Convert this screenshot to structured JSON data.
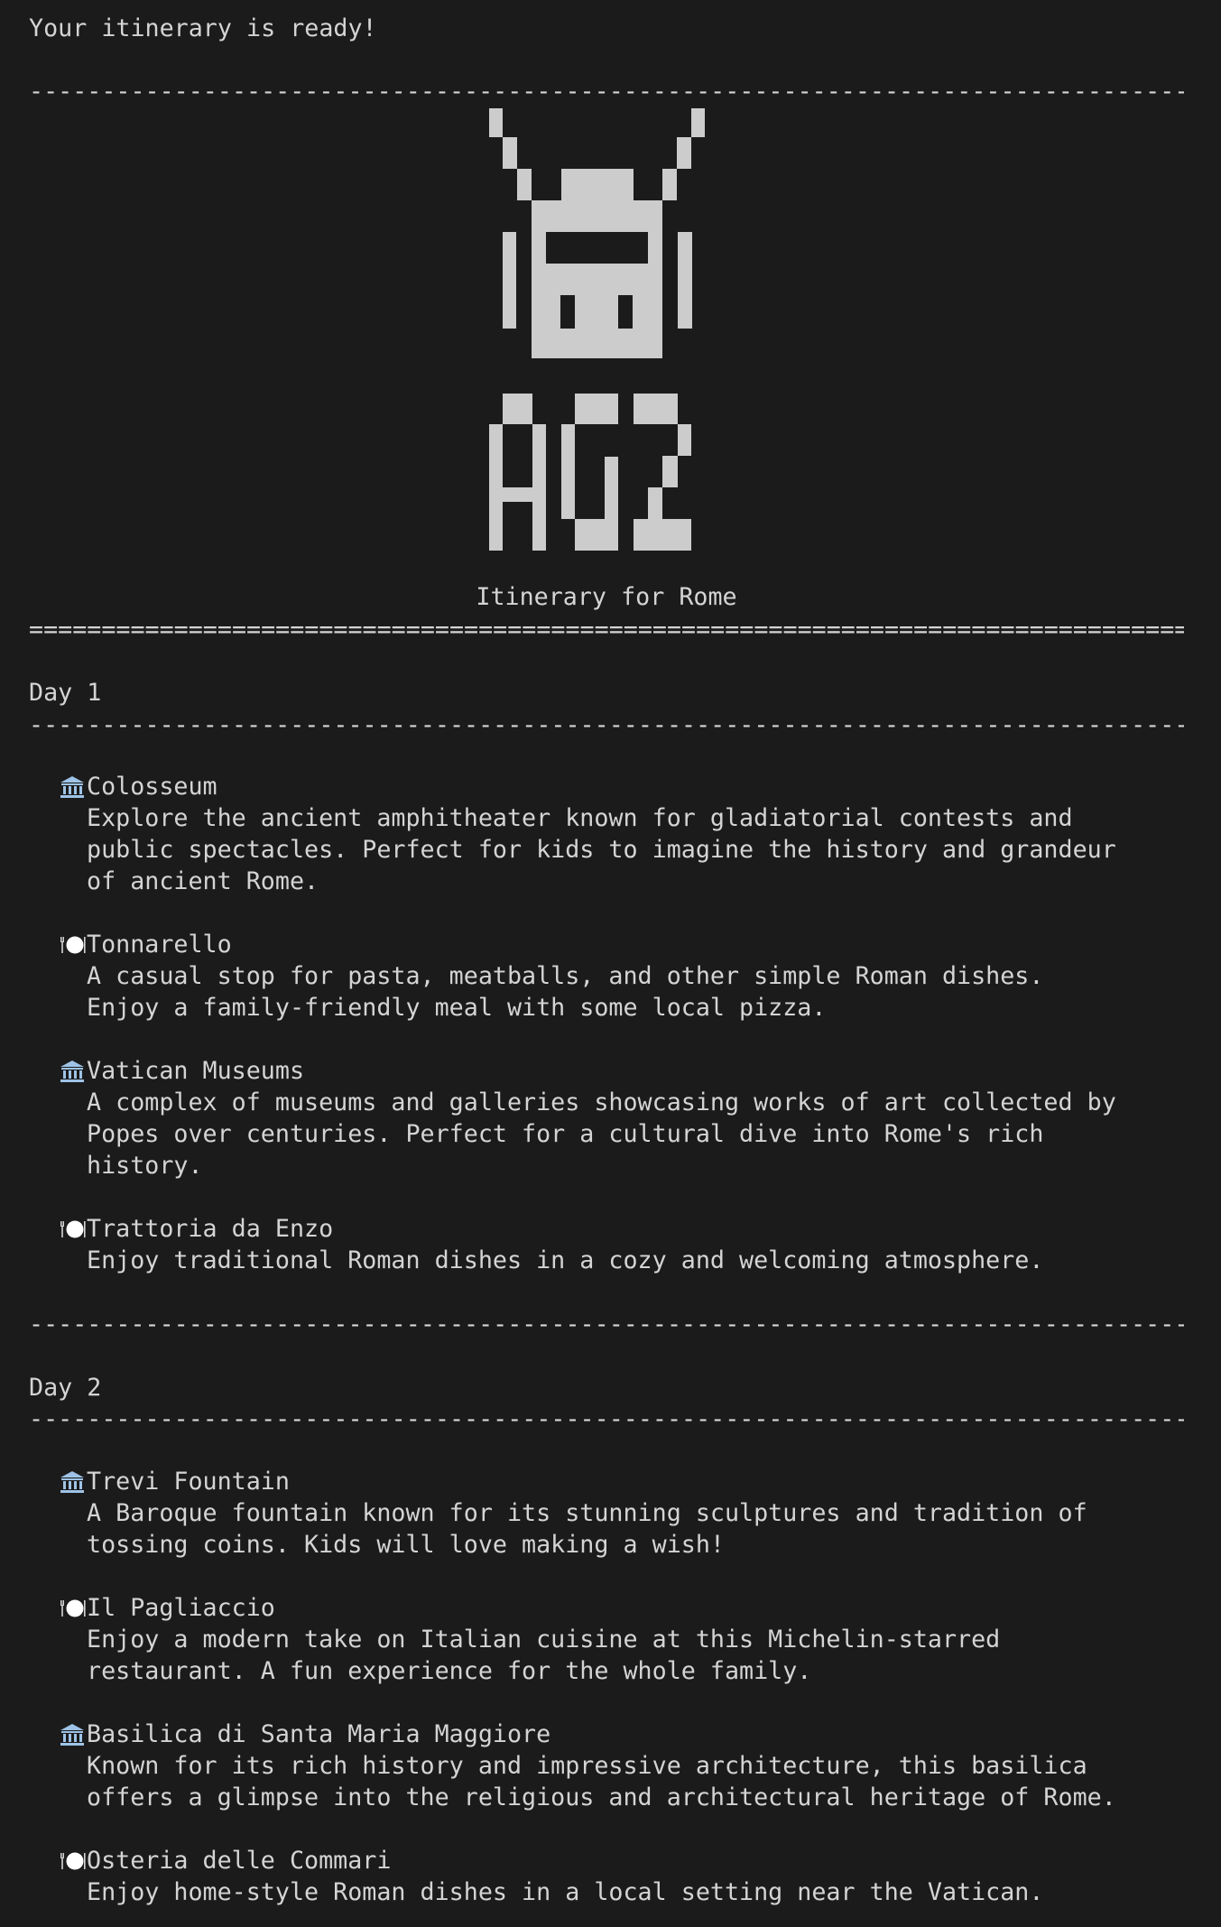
{
  "header": {
    "ready_message": "Your itinerary is ready!",
    "logo_text": "AG2",
    "title": "Itinerary for Rome"
  },
  "rules": {
    "dash": "--------------------------------------------------------------------------------",
    "equals": "================================================================================"
  },
  "colors": {
    "background": "#1b1b1b",
    "text": "#d4d4d4",
    "logo": "#cccccc",
    "landmark_icon": "#9ec3e6"
  },
  "days": [
    {
      "label": "Day 1",
      "items": [
        {
          "icon": "landmark-icon",
          "name": "Colosseum",
          "description": "Explore the ancient amphitheater known for gladiatorial contests and\npublic spectacles. Perfect for kids to imagine the history and grandeur\nof ancient Rome."
        },
        {
          "icon": "restaurant-icon",
          "name": "Tonnarello",
          "description": "A casual stop for pasta, meatballs, and other simple Roman dishes.\nEnjoy a family-friendly meal with some local pizza."
        },
        {
          "icon": "landmark-icon",
          "name": "Vatican Museums",
          "description": "A complex of museums and galleries showcasing works of art collected by\nPopes over centuries. Perfect for a cultural dive into Rome's rich\nhistory."
        },
        {
          "icon": "restaurant-icon",
          "name": "Trattoria da Enzo",
          "description": "Enjoy traditional Roman dishes in a cozy and welcoming atmosphere."
        }
      ]
    },
    {
      "label": "Day 2",
      "items": [
        {
          "icon": "landmark-icon",
          "name": "Trevi Fountain",
          "description": "A Baroque fountain known for its stunning sculptures and tradition of\ntossing coins. Kids will love making a wish!"
        },
        {
          "icon": "restaurant-icon",
          "name": "Il Pagliaccio",
          "description": "Enjoy a modern take on Italian cuisine at this Michelin-starred\nrestaurant. A fun experience for the whole family."
        },
        {
          "icon": "landmark-icon",
          "name": "Basilica di Santa Maria Maggiore",
          "description": "Known for its rich history and impressive architecture, this basilica\noffers a glimpse into the religious and architectural heritage of Rome."
        },
        {
          "icon": "restaurant-icon",
          "name": "Osteria delle Commari",
          "description": "Enjoy home-style Roman dishes in a local setting near the Vatican."
        }
      ]
    }
  ]
}
